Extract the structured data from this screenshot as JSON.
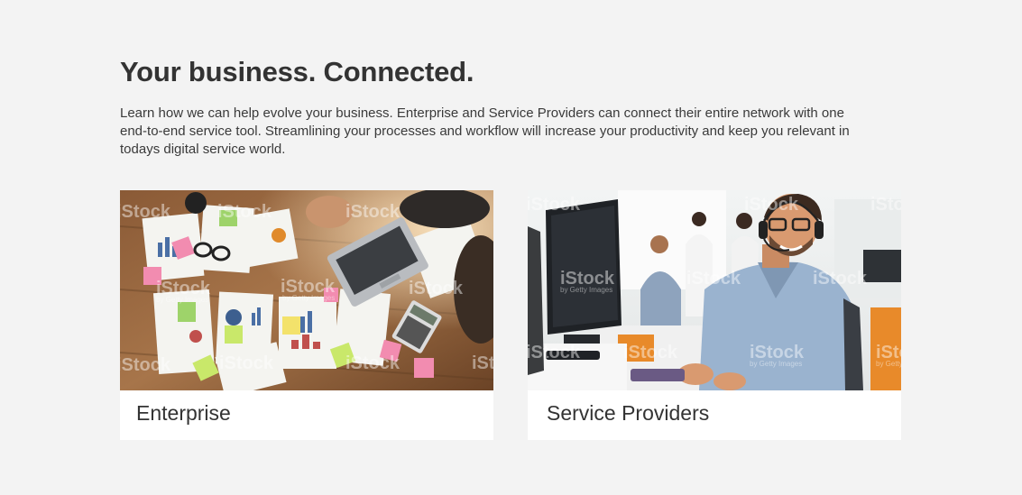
{
  "section": {
    "title": "Your business. Connected.",
    "intro": "Learn how we can help evolve your business. Enterprise and Service Providers can connect their entire network with one end-to-end service tool. Streamlining your processes and workflow will increase your productivity and keep you relevant in todays digital service world."
  },
  "cards": [
    {
      "label": "Enterprise",
      "image": "office-desk-photo"
    },
    {
      "label": "Service Providers",
      "image": "call-center-photo"
    }
  ],
  "watermark": {
    "brand": "iStock",
    "credit": "by Getty Images"
  }
}
